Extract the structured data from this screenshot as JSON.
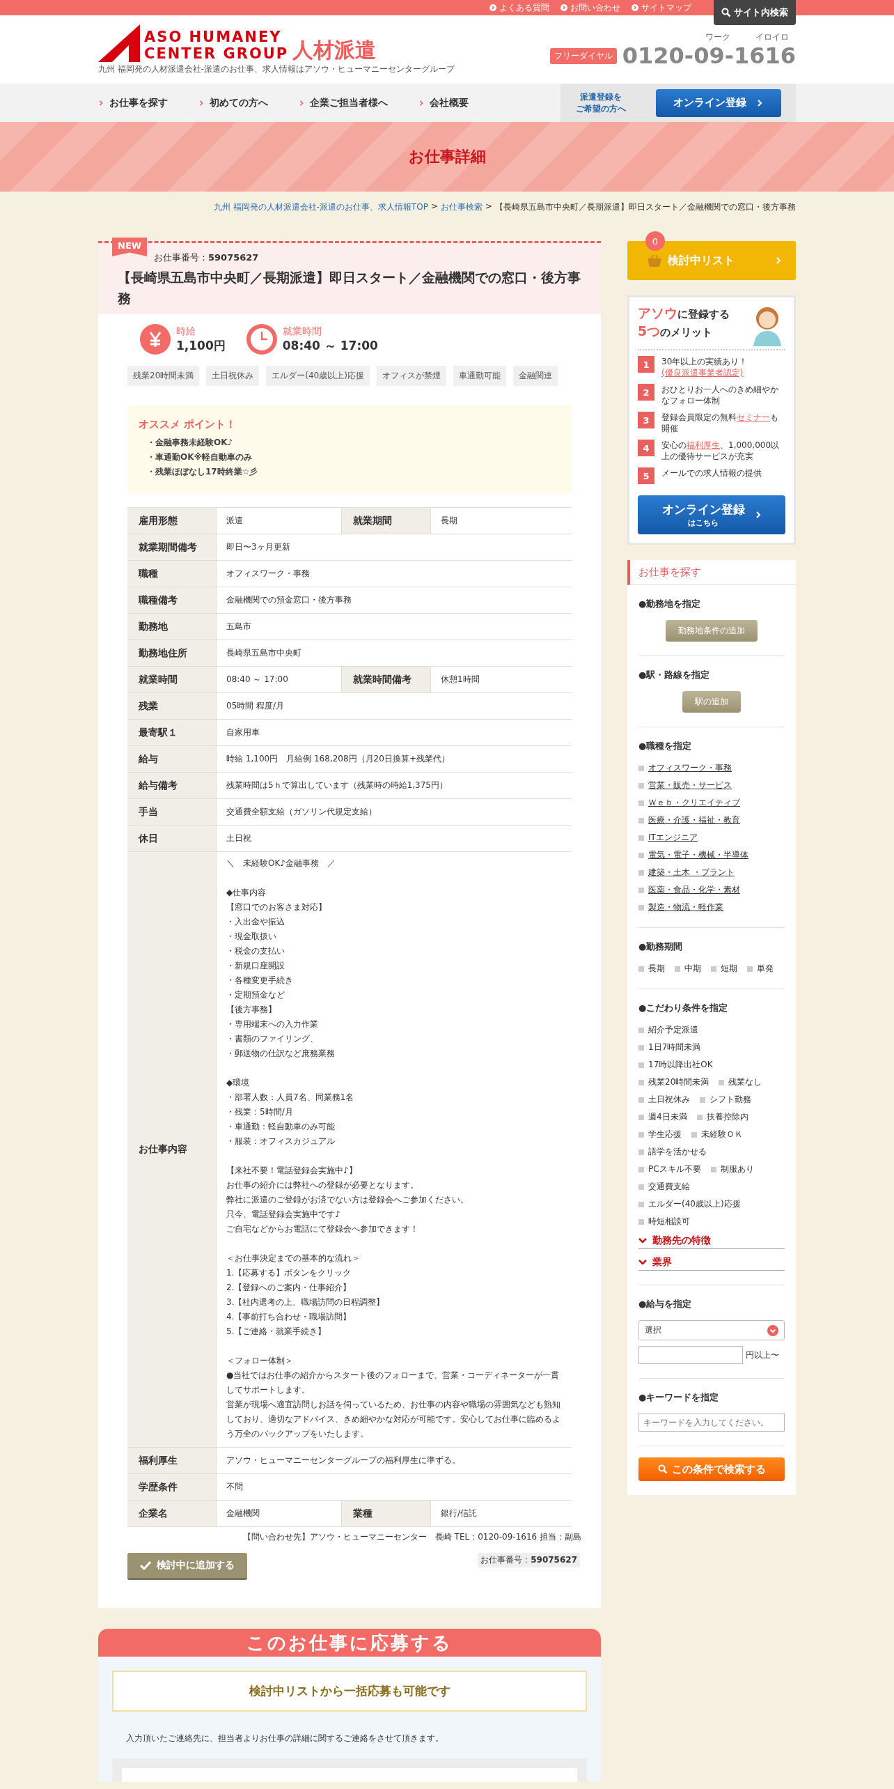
{
  "top_links": [
    "よくある質問",
    "お問い合わせ",
    "サイトマップ"
  ],
  "site_search": "サイト内検索",
  "logo": {
    "line1": "ASO HUMANEY",
    "line2": "CENTER GROUP",
    "service": "人材派遣",
    "tagline": "九州 福岡発の人材派遣会社-派遣のお仕事、求人情報はアソウ・ヒューマニーセンターグループ"
  },
  "phone": {
    "badge": "フリーダイヤル",
    "ruby1": "ワーク",
    "ruby2": "イロイロ",
    "number": "0120-09-1616"
  },
  "nav": [
    "お仕事を探す",
    "初めての方へ",
    "企業ご担当者様へ",
    "会社概要"
  ],
  "nav_register": {
    "note": [
      "派遣登録を",
      "ご希望の方へ"
    ],
    "button": "オンライン登録"
  },
  "banner_title": "お仕事詳細",
  "breadcrumb": {
    "links": [
      "九州 福岡発の人材派遣会社-派遣のお仕事、求人情報TOP",
      "お仕事検索"
    ],
    "separator": ">",
    "current": "【長崎県五島市中央町／長期派遣】即日スタート／金融機関での窓口・後方事務"
  },
  "job": {
    "new_badge": "NEW",
    "number_label": "お仕事番号：",
    "number": "59075627",
    "title": "【長崎県五島市中央町／長期派遣】即日スタート／金融機関での窓口・後方事務",
    "highlights": [
      {
        "kind": "pay",
        "label": "時給",
        "value": "1,100円"
      },
      {
        "kind": "hours",
        "label": "就業時間",
        "value": "08:40 ～ 17:00"
      }
    ],
    "tags": [
      "残業20時間未満",
      "土日祝休み",
      "エルダー(40歳以上)応援",
      "オフィスが禁煙",
      "車通勤可能",
      "金融関連"
    ],
    "recommend": {
      "title": "オススメ ポイント！",
      "points": [
        "・金融事務未経験OK♪",
        "・車通勤OK※軽自動車のみ",
        "・残業ほぼなし17時終業☆彡"
      ]
    },
    "rows": [
      {
        "kind": "double",
        "cells": [
          {
            "label": "雇用形態",
            "value": "派遣"
          },
          {
            "label": "就業期間",
            "value": "長期"
          }
        ]
      },
      {
        "kind": "single",
        "cells": [
          {
            "label": "就業期間備考",
            "value": "即日〜3ヶ月更新"
          }
        ]
      },
      {
        "kind": "single",
        "cells": [
          {
            "label": "職種",
            "value": "オフィスワーク・事務"
          }
        ]
      },
      {
        "kind": "single",
        "cells": [
          {
            "label": "職種備考",
            "value": "金融機関での預金窓口・後方事務"
          }
        ]
      },
      {
        "kind": "single",
        "cells": [
          {
            "label": "勤務地",
            "value": "五島市"
          }
        ]
      },
      {
        "kind": "single",
        "cells": [
          {
            "label": "勤務地住所",
            "value": "長崎県五島市中央町"
          }
        ]
      },
      {
        "kind": "double",
        "cells": [
          {
            "label": "就業時間",
            "value": "08:40 ～ 17:00"
          },
          {
            "label": "就業時間備考",
            "value": "休憩1時間"
          }
        ]
      },
      {
        "kind": "single",
        "cells": [
          {
            "label": "残業",
            "value": "05時間 程度/月"
          }
        ]
      },
      {
        "kind": "single",
        "cells": [
          {
            "label": "最寄駅１",
            "value": "自家用車"
          }
        ]
      },
      {
        "kind": "single",
        "cells": [
          {
            "label": "給与",
            "value": "時給 1,100円　月給例 168,208円（月20日換算+残業代）"
          }
        ]
      },
      {
        "kind": "single",
        "cells": [
          {
            "label": "給与備考",
            "value": "残業時間は5ｈで算出しています（残業時の時給1,375円）"
          }
        ]
      },
      {
        "kind": "single",
        "cells": [
          {
            "label": "手当",
            "value": "交通費全額支給（ガソリン代規定支給）"
          }
        ]
      },
      {
        "kind": "single",
        "cells": [
          {
            "label": "休日",
            "value": "土日祝"
          }
        ]
      },
      {
        "kind": "description",
        "label": "お仕事内容",
        "paragraphs": [
          [
            "＼　未経験OK♪金融事務　／"
          ],
          [
            "◆仕事内容",
            "【窓口でのお客さま対応】",
            "・入出金や振込",
            "・現金取扱い",
            "・税金の支払い",
            "・新規口座開設",
            "・各種変更手続き",
            "・定期預金など",
            "【後方事務】",
            "・専用端末への入力作業",
            "・書類のファイリング、",
            "・郵送物の仕訳など庶務業務"
          ],
          [
            "◆環境",
            "・部署人数：人員7名、同業務1名",
            "・残業：5時間/月",
            "・車通勤：軽自動車のみ可能",
            "・服装：オフィスカジュアル"
          ],
          [
            "【来社不要！電話登録会実施中♪】",
            "お仕事の紹介には弊社への登録が必要となります。",
            "弊社に派遣のご登録がお済でない方は登録会へご参加ください。",
            "只今、電話登録会実施中です♪",
            "ご自宅などからお電話にて登録会へ参加できます！"
          ],
          [
            "＜お仕事決定までの基本的な流れ＞",
            "1.【応募する】ボタンをクリック",
            "2.【登録へのご案内・仕事紹介】",
            "3.【社内選考の上、職場訪問の日程調整】",
            "4.【事前打ち合わせ・職場訪問】",
            "5.【ご連絡・就業手続き】"
          ],
          [
            "＜フォロー体制＞",
            "●当社ではお仕事の紹介からスタート後のフォローまで、営業・コーディネーターが一貫してサポートします。",
            "営業が現場へ適宜訪問しお話を伺っているため、お仕事の内容や職場の雰囲気なども熟知しており、適切なアドバイス、きめ細やかな対応が可能です。安心してお仕事に臨めるよう万全のバックアップをいたします。"
          ]
        ]
      },
      {
        "kind": "single",
        "cells": [
          {
            "label": "福利厚生",
            "value": "アソウ・ヒューマニーセンターグループの福利厚生に準ずる。"
          }
        ]
      },
      {
        "kind": "single",
        "cells": [
          {
            "label": "学歴条件",
            "value": "不問"
          }
        ]
      },
      {
        "kind": "double",
        "cells": [
          {
            "label": "企業名",
            "value": "金融機関"
          },
          {
            "label": "業種",
            "value": "銀行/信託"
          }
        ]
      }
    ],
    "contact": "【問い合わせ先】アソウ・ヒューマニーセンター　長崎 TEL：0120-09-1616 担当：副島",
    "add_button": "検討中に追加する",
    "footer_number_label": "お仕事番号：",
    "footer_number": "59075627"
  },
  "apply": {
    "title": "このお仕事に応募する",
    "bulk_note": "検討中リストから一括応募も可能です",
    "text": "入力頂いたご連絡先に、担当者よりお仕事の詳細に関するご連絡をさせて頂きます。"
  },
  "sidebar": {
    "list_button": {
      "label": "検討中リスト",
      "count": "0"
    },
    "merits": {
      "title": [
        [
          {
            "text": "アソウ",
            "accent": true
          },
          {
            "text": "に登録する",
            "accent": false
          }
        ],
        [
          {
            "text": "5つ",
            "accent": true
          },
          {
            "text": "のメリット",
            "accent": false
          }
        ]
      ],
      "items": [
        {
          "number": "1",
          "segments": [
            {
              "text": "30年以上の実績あり！",
              "link": false
            },
            {
              "text": "(優良派遣事業者認定)",
              "link": true
            }
          ]
        },
        {
          "number": "2",
          "segments": [
            {
              "text": "おひとりお一人へのきめ細やかなフォロー体制",
              "link": false
            }
          ]
        },
        {
          "number": "3",
          "segments": [
            {
              "text": "登録会員限定の無料",
              "link": false
            },
            {
              "text": "セミナー",
              "link": true
            },
            {
              "text": "も開催",
              "link": false
            }
          ]
        },
        {
          "number": "4",
          "segments": [
            {
              "text": "安心の",
              "link": false
            },
            {
              "text": "福利厚生",
              "link": true
            },
            {
              "text": "、1,000,000以上の優待サービスが充実",
              "link": false
            }
          ]
        },
        {
          "number": "5",
          "segments": [
            {
              "text": "メールでの求人情報の提供",
              "link": false
            }
          ]
        }
      ],
      "button": {
        "main": "オンライン登録",
        "sub": "はこちら"
      }
    },
    "search": {
      "title": "お仕事を探す",
      "sections": [
        {
          "kind": "button",
          "heading": "●勤務地を指定",
          "button": "勤務地条件の追加"
        },
        {
          "kind": "button",
          "heading": "●駅・路線を指定",
          "button": "駅の追加"
        },
        {
          "kind": "links",
          "heading": "●職種を指定",
          "rows": [
            [
              "オフィスワーク・事務"
            ],
            [
              "営業・販売・サービス"
            ],
            [
              "Ｗｅｂ・クリエイティブ"
            ],
            [
              "医療・介護・福祉・教育"
            ],
            [
              "ITエンジニア"
            ],
            [
              "電気・電子・機械・半導体"
            ],
            [
              "建築・土木 ・プラント"
            ],
            [
              "医薬・食品・化学・素材"
            ],
            [
              "製造・物流・軽作業"
            ]
          ]
        },
        {
          "kind": "options",
          "heading": "●勤務期間",
          "rows": [
            [
              "長期",
              "中期",
              "短期",
              "単発"
            ]
          ]
        },
        {
          "kind": "options",
          "heading": "●こだわり条件を指定",
          "rows": [
            [
              "紹介予定派遣"
            ],
            [
              "1日7時間未満"
            ],
            [
              "17時以降出社OK"
            ],
            [
              "残業20時間未満",
              "残業なし"
            ],
            [
              "土日祝休み",
              "シフト勤務"
            ],
            [
              "週4日未満",
              "扶養控除内"
            ],
            [
              "学生応援",
              "未経験ＯＫ"
            ],
            [
              "語学を活かせる"
            ],
            [
              "PCスキル不要",
              "制服あり"
            ],
            [
              "交通費支給"
            ],
            [
              "エルダー(40歳以上)応援"
            ],
            [
              "時短相談可"
            ]
          ],
          "expanders": [
            {
              "label": "勤務先の特徴",
              "expanded": false
            },
            {
              "label": "業界",
              "expanded": false
            }
          ]
        },
        {
          "kind": "salary",
          "heading": "●給与を指定",
          "select": "選択",
          "suffix": "円以上〜"
        },
        {
          "kind": "keyword",
          "heading": "●キーワードを指定",
          "placeholder": "キーワードを入力してください。"
        }
      ],
      "submit": "この条件で検索する"
    }
  }
}
